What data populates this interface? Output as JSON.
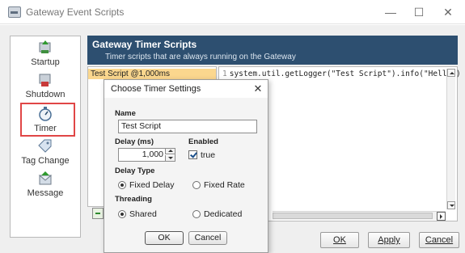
{
  "window": {
    "title": "Gateway Event Scripts",
    "controls": {
      "minimize": "—",
      "maximize": "☐",
      "close": "✕"
    }
  },
  "sidebar": {
    "items": [
      {
        "label": "Startup",
        "icon": "startup-icon"
      },
      {
        "label": "Shutdown",
        "icon": "shutdown-icon"
      },
      {
        "label": "Timer",
        "icon": "stopwatch-icon"
      },
      {
        "label": "Tag Change",
        "icon": "tag-icon"
      },
      {
        "label": "Message",
        "icon": "message-icon"
      }
    ],
    "selected": "Timer"
  },
  "header": {
    "title": "Gateway Timer Scripts",
    "subtitle": "Timer scripts that are always running on the Gateway"
  },
  "script_list": {
    "items": [
      "Test Script @1,000ms"
    ]
  },
  "editor": {
    "line_number": "1",
    "code": "system.util.getLogger(\"Test Script\").info(\"Hello\")"
  },
  "dialog": {
    "title": "Choose Timer Settings",
    "close": "✕",
    "name_label": "Name",
    "name_value": "Test Script",
    "delay_label": "Delay (ms)",
    "delay_value": "1,000",
    "enabled_label": "Enabled",
    "enabled_value": "true",
    "delay_type_label": "Delay Type",
    "delay_type_options": [
      "Fixed Delay",
      "Fixed Rate"
    ],
    "delay_type_selected": "Fixed Delay",
    "threading_label": "Threading",
    "threading_options": [
      "Shared",
      "Dedicated"
    ],
    "threading_selected": "Shared",
    "ok_label": "OK",
    "cancel_label": "Cancel"
  },
  "buttons": {
    "ok": "OK",
    "apply": "Apply",
    "cancel": "Cancel"
  },
  "colors": {
    "header_bg": "#2d4f70",
    "selected_row": "#fbd78e",
    "selection_outline": "#e04646"
  }
}
